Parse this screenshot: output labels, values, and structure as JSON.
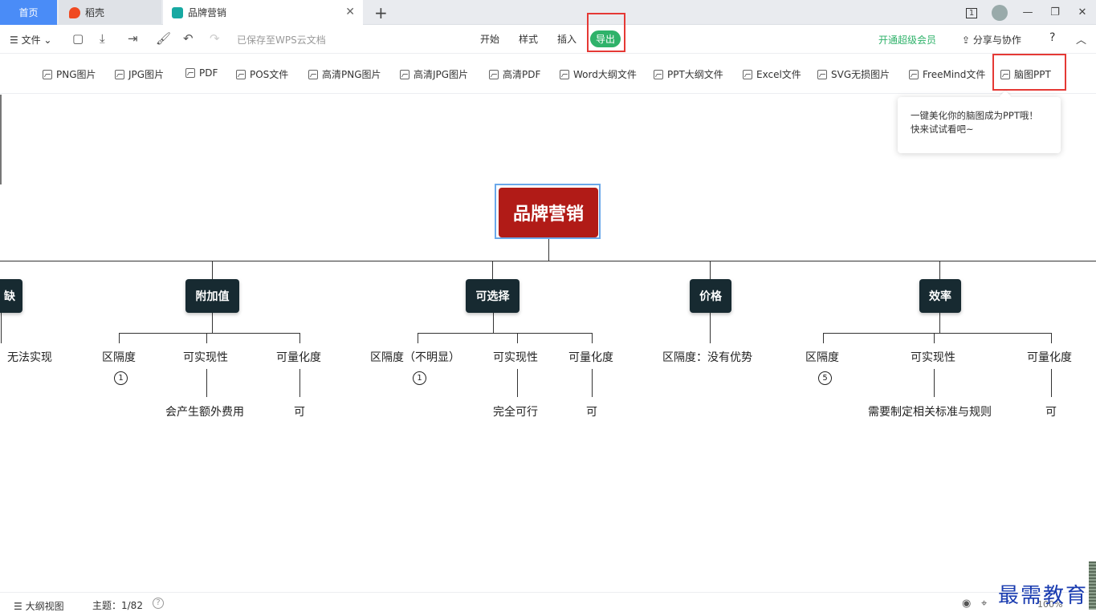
{
  "tabs": [
    {
      "label": "首页"
    },
    {
      "label": "稻壳"
    },
    {
      "label": "品牌营销"
    }
  ],
  "window": {
    "counter": "1"
  },
  "menubar": {
    "file_label": "文件",
    "saved_text": "已保存至WPS云文档",
    "tabs": [
      "开始",
      "样式",
      "插入",
      "导出"
    ],
    "vip_label": "开通超级会员",
    "share_label": "分享与协作",
    "help_label": "?"
  },
  "export_toolbar": [
    {
      "label": "PNG图片"
    },
    {
      "label": "JPG图片"
    },
    {
      "label": "PDF"
    },
    {
      "label": "POS文件"
    },
    {
      "label": "高清PNG图片"
    },
    {
      "label": "高清JPG图片"
    },
    {
      "label": "高清PDF"
    },
    {
      "label": "Word大纲文件"
    },
    {
      "label": "PPT大纲文件"
    },
    {
      "label": "Excel文件"
    },
    {
      "label": "SVG无损图片"
    },
    {
      "label": "FreeMind文件"
    },
    {
      "label": "脑图PPT"
    }
  ],
  "tooltip": {
    "line1": "一键美化你的脑图成为PPT哦！",
    "line2": "快来试试看吧~"
  },
  "mindmap": {
    "root": "品牌营销",
    "branches": [
      {
        "label": "缺",
        "children": [
          {
            "label": "无法实现"
          }
        ]
      },
      {
        "label": "附加值",
        "children": [
          {
            "label": "区隔度",
            "badge": "1"
          },
          {
            "label": "可实现性",
            "sub": "会产生额外费用"
          },
          {
            "label": "可量化度",
            "sub": "可"
          }
        ]
      },
      {
        "label": "可选择",
        "children": [
          {
            "label": "区隔度（不明显）",
            "badge": "1"
          },
          {
            "label": "可实现性",
            "sub": "完全可行"
          },
          {
            "label": "可量化度",
            "sub": "可"
          }
        ]
      },
      {
        "label": "价格",
        "children": [
          {
            "label": "区隔度：没有优势"
          }
        ]
      },
      {
        "label": "效率",
        "children": [
          {
            "label": "区隔度",
            "badge": "5"
          },
          {
            "label": "可实现性",
            "sub": "需要制定相关标准与规则"
          },
          {
            "label": "可量化度",
            "sub": "可"
          }
        ]
      }
    ]
  },
  "statusbar": {
    "outline_label": "大纲视图",
    "topic_count": "主题：1/82",
    "zoom": "100%"
  },
  "watermark": "最需教育"
}
